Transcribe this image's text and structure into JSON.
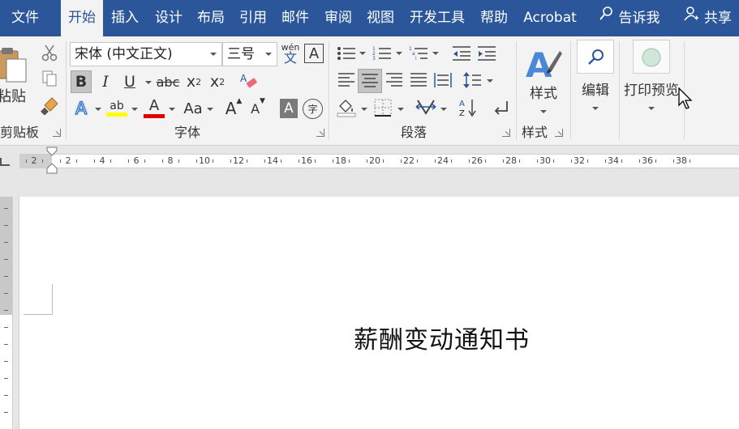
{
  "tabs": [
    {
      "label": "文件"
    },
    {
      "label": "开始"
    },
    {
      "label": "插入"
    },
    {
      "label": "设计"
    },
    {
      "label": "布局"
    },
    {
      "label": "引用"
    },
    {
      "label": "邮件"
    },
    {
      "label": "审阅"
    },
    {
      "label": "视图"
    },
    {
      "label": "开发工具"
    },
    {
      "label": "帮助"
    },
    {
      "label": "Acrobat"
    }
  ],
  "tell_me": "告诉我",
  "share": "共享",
  "clipboard": {
    "paste_label": "粘贴",
    "group_label": "剪贴板"
  },
  "font": {
    "font_name": "宋体 (中文正文)",
    "font_size": "三号",
    "phonetic_top": "wén",
    "phonetic_bottom": "文",
    "border_char": "A",
    "bold": "B",
    "italic": "I",
    "underline": "U",
    "strike": "abc",
    "subscript": "x",
    "subscript_mark": "2",
    "superscript": "x",
    "superscript_mark": "2",
    "text_effect": "A",
    "highlight": "ab",
    "font_color": "A",
    "change_case": "Aa",
    "grow": "A",
    "shrink": "A",
    "shading": "A",
    "enclose": "字",
    "group_label": "字体"
  },
  "paragraph": {
    "group_label": "段落",
    "sort_label": "A Z"
  },
  "styles": {
    "label": "样式",
    "group_label": "样式"
  },
  "editing": {
    "label": "编辑"
  },
  "print_preview": {
    "label": "打印预览"
  },
  "ruler": {
    "numbers": [
      "2",
      "2",
      "4",
      "6",
      "8",
      "10",
      "12",
      "14",
      "16",
      "18",
      "20",
      "22",
      "24",
      "26",
      "28",
      "30",
      "32",
      "34",
      "36",
      "38"
    ]
  },
  "document": {
    "title": "薪酬变动通知书"
  },
  "colors": {
    "brand": "#2b579a",
    "highlight": "#ffff00",
    "font_color": "#e00000"
  }
}
